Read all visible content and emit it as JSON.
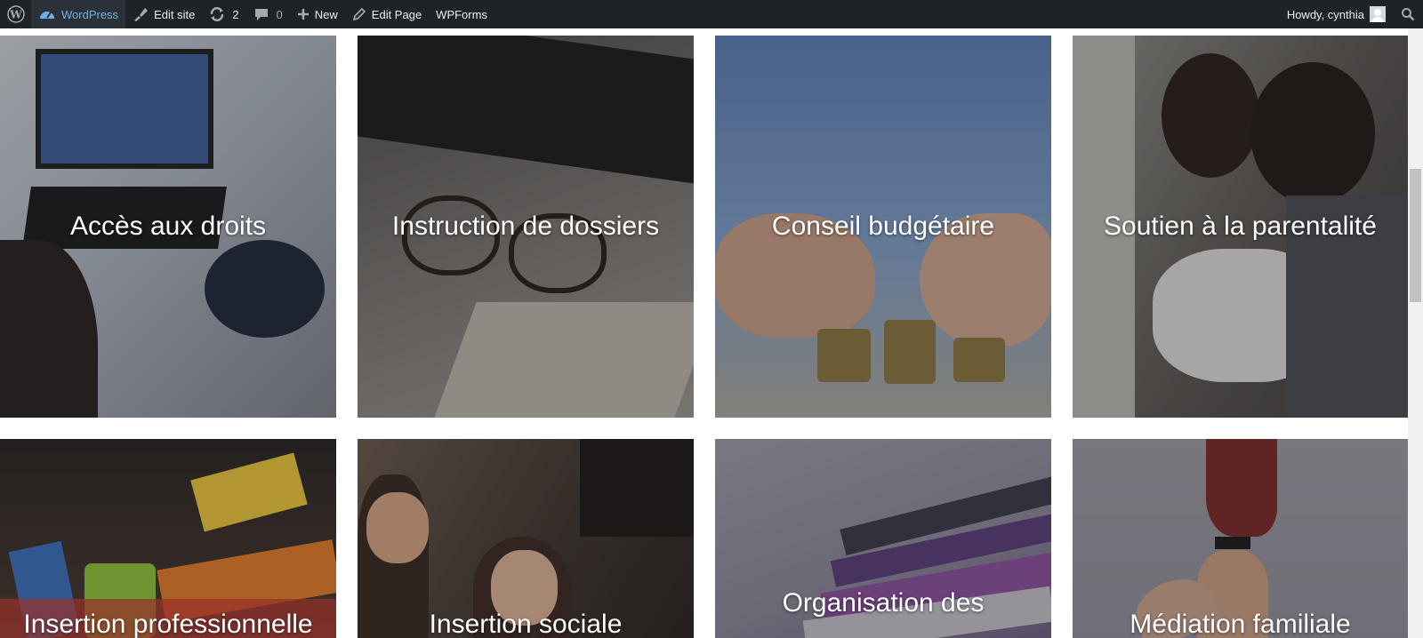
{
  "adminbar": {
    "site_name": "WordPress",
    "edit_site": "Edit site",
    "updates_count": "2",
    "comments_count": "0",
    "new_label": "New",
    "edit_page": "Edit Page",
    "wpforms": "WPForms",
    "howdy": "Howdy, cynthia",
    "icons": [
      "wordpress-logo-icon",
      "dashboard-icon",
      "brush-icon",
      "updates-icon",
      "comment-icon",
      "plus-icon",
      "pencil-icon",
      "avatar",
      "search-icon"
    ]
  },
  "tiles": [
    {
      "title": "Accès aux droits",
      "color": "#8a8f98"
    },
    {
      "title": "Instruction de dossiers",
      "color": "#5a5856"
    },
    {
      "title": "Conseil budgétaire",
      "color": "#6f8fb8"
    },
    {
      "title": "Soutien à la parentalité",
      "color": "#6c6560"
    },
    {
      "title": "Insertion professionnelle",
      "color": "#3a3432"
    },
    {
      "title": "Insertion sociale",
      "color": "#4a3c32"
    },
    {
      "title": "Organisation des",
      "color": "#8e8a98"
    },
    {
      "title": "Médiation familiale",
      "color": "#8e8c94"
    }
  ]
}
